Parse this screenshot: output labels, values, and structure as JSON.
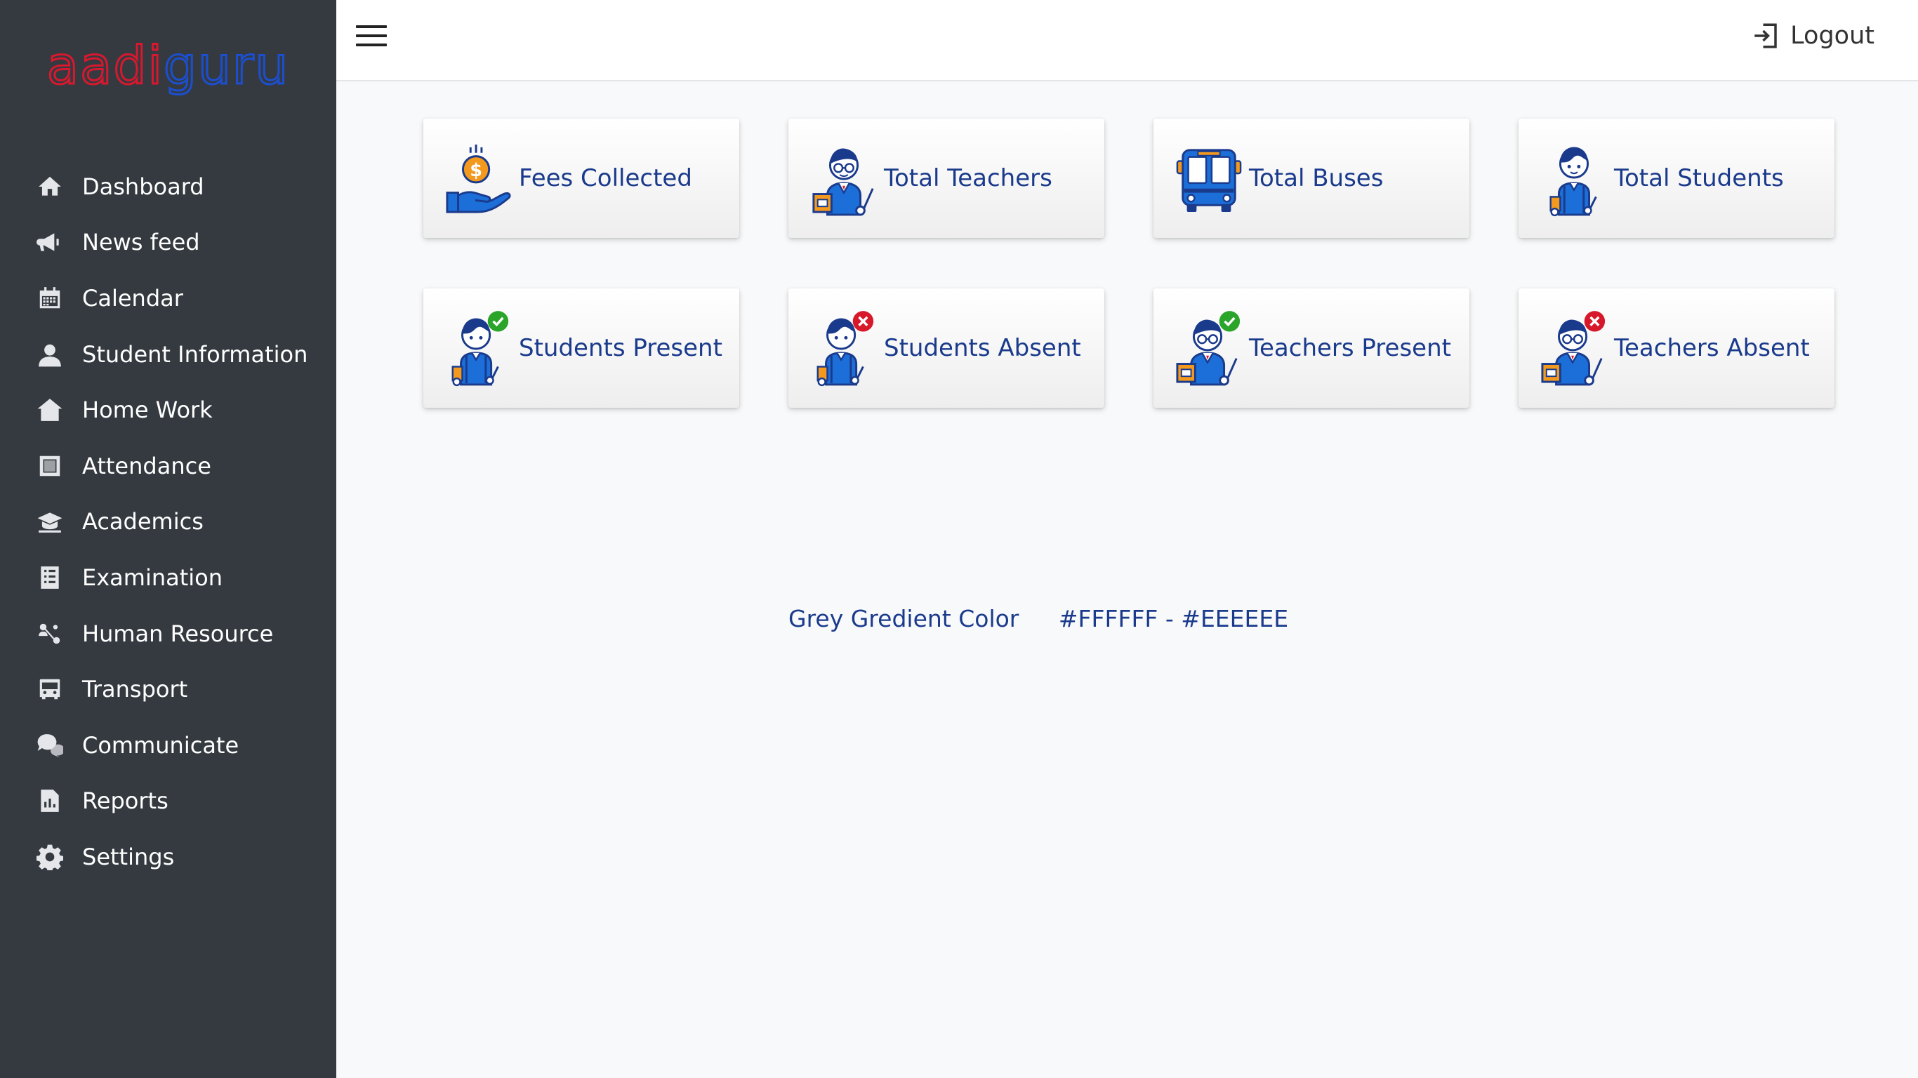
{
  "brand": {
    "logo_text_a": "aadi",
    "logo_text_b": "guru",
    "logo_colors": {
      "primary": "#d8182e",
      "secondary": "#1c4fd0"
    }
  },
  "sidebar": {
    "background": "#343a40",
    "items": [
      {
        "label": "Dashboard",
        "icon": "home-icon"
      },
      {
        "label": "News feed",
        "icon": "megaphone-icon"
      },
      {
        "label": "Calendar",
        "icon": "calendar-icon"
      },
      {
        "label": "Student Information",
        "icon": "user-icon"
      },
      {
        "label": "Home Work",
        "icon": "house-icon"
      },
      {
        "label": "Attendance",
        "icon": "square-icon"
      },
      {
        "label": "Academics",
        "icon": "graduation-cap-icon"
      },
      {
        "label": "Examination",
        "icon": "exam-sheet-icon"
      },
      {
        "label": "Human Resource",
        "icon": "people-network-icon"
      },
      {
        "label": "Transport",
        "icon": "bus-icon"
      },
      {
        "label": "Communicate",
        "icon": "chat-icon"
      },
      {
        "label": "Reports",
        "icon": "report-icon"
      },
      {
        "label": "Settings",
        "icon": "gear-icon"
      }
    ]
  },
  "topbar": {
    "menu_icon": "hamburger-icon",
    "logout_label": "Logout",
    "logout_icon": "sign-in-icon"
  },
  "cards": [
    {
      "label": "Fees Collected",
      "icon": "money-hand-icon"
    },
    {
      "label": "Total Teachers",
      "icon": "teacher-icon"
    },
    {
      "label": "Total Buses",
      "icon": "bus-front-icon"
    },
    {
      "label": "Total Students",
      "icon": "student-icon"
    },
    {
      "label": "Students Present",
      "icon": "student-present-icon"
    },
    {
      "label": "Students Absent",
      "icon": "student-absent-icon"
    },
    {
      "label": "Teachers Present",
      "icon": "teacher-present-icon"
    },
    {
      "label": "Teachers Absent",
      "icon": "teacher-absent-icon"
    }
  ],
  "note": {
    "label": "Grey Gredient Color",
    "value": "#FFFFFF - #EEEEEE"
  },
  "colors": {
    "card_text": "#1a3a8c",
    "card_gradient_start": "#FFFFFF",
    "card_gradient_end": "#EEEEEE",
    "present_badge": "#2aa52a",
    "absent_badge": "#d7182a",
    "accent_orange": "#f39a1e",
    "accent_blue": "#1c6fd8"
  }
}
